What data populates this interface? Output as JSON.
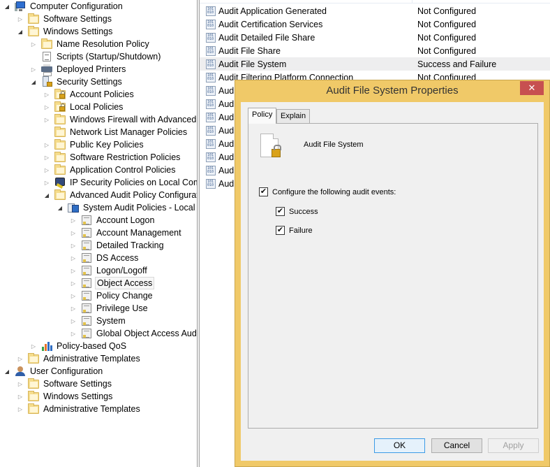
{
  "tree": [
    {
      "label": "Computer Configuration",
      "level": 0,
      "expander": "open",
      "icon": "computer-icon"
    },
    {
      "label": "Software Settings",
      "level": 1,
      "expander": "closed",
      "icon": "folder-icon"
    },
    {
      "label": "Windows Settings",
      "level": 1,
      "expander": "open",
      "icon": "folder-icon"
    },
    {
      "label": "Name Resolution Policy",
      "level": 2,
      "expander": "closed",
      "icon": "folder-icon"
    },
    {
      "label": "Scripts (Startup/Shutdown)",
      "level": 2,
      "expander": "none",
      "icon": "script-icon"
    },
    {
      "label": "Deployed Printers",
      "level": 2,
      "expander": "closed",
      "icon": "printer-icon"
    },
    {
      "label": "Security Settings",
      "level": 2,
      "expander": "open",
      "icon": "security-settings-icon"
    },
    {
      "label": "Account Policies",
      "level": 3,
      "expander": "closed",
      "icon": "locked-folder-icon"
    },
    {
      "label": "Local Policies",
      "level": 3,
      "expander": "closed",
      "icon": "locked-folder-icon"
    },
    {
      "label": "Windows Firewall with Advanced Se",
      "level": 3,
      "expander": "closed",
      "icon": "folder-icon"
    },
    {
      "label": "Network List Manager Policies",
      "level": 3,
      "expander": "none",
      "icon": "folder-icon"
    },
    {
      "label": "Public Key Policies",
      "level": 3,
      "expander": "closed",
      "icon": "folder-icon"
    },
    {
      "label": "Software Restriction Policies",
      "level": 3,
      "expander": "closed",
      "icon": "folder-icon"
    },
    {
      "label": "Application Control Policies",
      "level": 3,
      "expander": "closed",
      "icon": "folder-icon"
    },
    {
      "label": "IP Security Policies on Local Compu",
      "level": 3,
      "expander": "closed",
      "icon": "ip-security-icon"
    },
    {
      "label": "Advanced Audit Policy Configuratio",
      "level": 3,
      "expander": "open",
      "icon": "folder-icon"
    },
    {
      "label": "System Audit Policies - Local Gro",
      "level": 4,
      "expander": "open",
      "icon": "system-audit-policies-icon"
    },
    {
      "label": "Account Logon",
      "level": 5,
      "expander": "closed",
      "icon": "audit-category-icon"
    },
    {
      "label": "Account Management",
      "level": 5,
      "expander": "closed",
      "icon": "audit-category-icon"
    },
    {
      "label": "Detailed Tracking",
      "level": 5,
      "expander": "closed",
      "icon": "audit-category-icon"
    },
    {
      "label": "DS Access",
      "level": 5,
      "expander": "closed",
      "icon": "audit-category-icon"
    },
    {
      "label": "Logon/Logoff",
      "level": 5,
      "expander": "closed",
      "icon": "audit-category-icon"
    },
    {
      "label": "Object Access",
      "level": 5,
      "expander": "closed",
      "icon": "audit-category-icon",
      "selected": true
    },
    {
      "label": "Policy Change",
      "level": 5,
      "expander": "closed",
      "icon": "audit-category-icon"
    },
    {
      "label": "Privilege Use",
      "level": 5,
      "expander": "closed",
      "icon": "audit-category-icon"
    },
    {
      "label": "System",
      "level": 5,
      "expander": "closed",
      "icon": "audit-category-icon"
    },
    {
      "label": "Global Object Access Auditin",
      "level": 5,
      "expander": "closed",
      "icon": "audit-category-icon"
    },
    {
      "label": "Policy-based QoS",
      "level": 2,
      "expander": "closed",
      "icon": "qos-icon"
    },
    {
      "label": "Administrative Templates",
      "level": 1,
      "expander": "closed",
      "icon": "folder-icon"
    },
    {
      "label": "User Configuration",
      "level": 0,
      "expander": "open",
      "icon": "user-icon"
    },
    {
      "label": "Software Settings",
      "level": 1,
      "expander": "closed",
      "icon": "folder-icon"
    },
    {
      "label": "Windows Settings",
      "level": 1,
      "expander": "closed",
      "icon": "folder-icon"
    },
    {
      "label": "Administrative Templates",
      "level": 1,
      "expander": "closed",
      "icon": "folder-icon"
    }
  ],
  "list": {
    "rows": [
      {
        "name": "Audit Application Generated",
        "value": "Not Configured"
      },
      {
        "name": "Audit Certification Services",
        "value": "Not Configured"
      },
      {
        "name": "Audit Detailed File Share",
        "value": "Not Configured"
      },
      {
        "name": "Audit File Share",
        "value": "Not Configured"
      },
      {
        "name": "Audit File System",
        "value": "Success and Failure",
        "selected": true
      },
      {
        "name": "Audit Filtering Platform Connection",
        "value": "Not Configured"
      },
      {
        "name": "Audi",
        "value": ""
      },
      {
        "name": "Audi",
        "value": ""
      },
      {
        "name": "Audi",
        "value": ""
      },
      {
        "name": "Audi",
        "value": ""
      },
      {
        "name": "Audi",
        "value": ""
      },
      {
        "name": "Audi",
        "value": ""
      },
      {
        "name": "Audi",
        "value": ""
      },
      {
        "name": "Audi",
        "value": ""
      }
    ]
  },
  "dialog": {
    "title": "Audit File System Properties",
    "close_label": "✕",
    "tabs": [
      {
        "label": "Policy",
        "active": true
      },
      {
        "label": "Explain",
        "active": false
      }
    ],
    "policy_name": "Audit File System",
    "configure": {
      "label": "Configure the following audit events:",
      "checked": true
    },
    "success": {
      "label": "Success",
      "checked": true
    },
    "failure": {
      "label": "Failure",
      "checked": true
    },
    "buttons": {
      "ok": "OK",
      "cancel": "Cancel",
      "apply": "Apply"
    }
  },
  "colors": {
    "dialog_frame": "#f0c968",
    "close_button": "#c75050",
    "selection": "#eeeeef"
  }
}
